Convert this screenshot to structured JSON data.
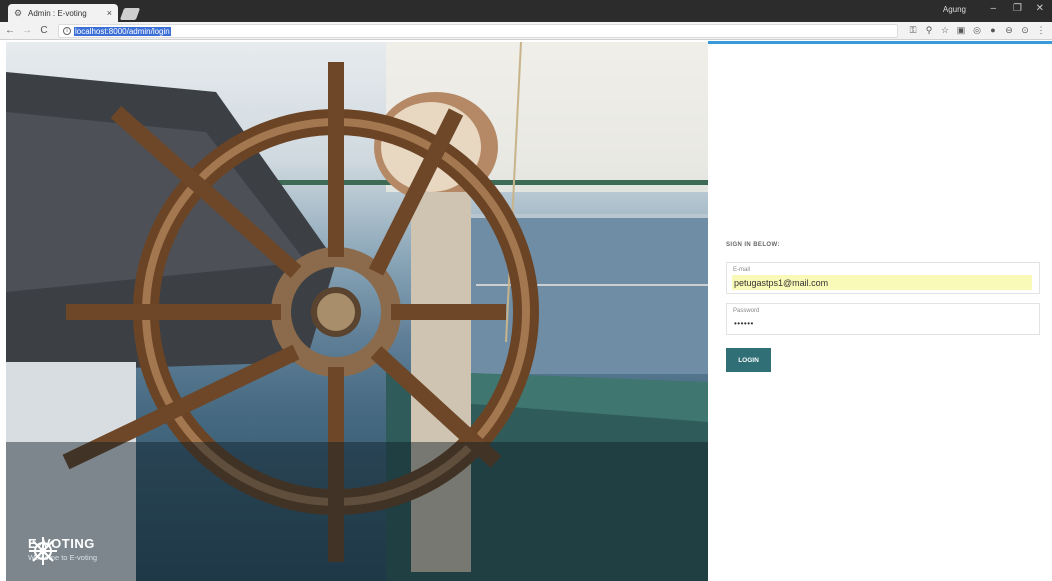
{
  "browser": {
    "tab_title": "Admin : E-voting",
    "tab_close": "×",
    "user": "Agung",
    "win_min": "–",
    "win_max": "❐",
    "win_close": "✕",
    "back": "←",
    "forward": "→",
    "reload": "C",
    "info": "i",
    "url": "localhost:8000/admin/login"
  },
  "brand": {
    "name": "E-VOTING",
    "tagline": "Welcome to E-voting"
  },
  "form": {
    "heading": "SIGN IN BELOW:",
    "email_label": "E-mail",
    "email_value": "petugastps1@mail.com",
    "password_label": "Password",
    "password_value": "••••••",
    "login_label": "LOGIN"
  },
  "colors": {
    "accent_bar": "#3a9ad9",
    "login_button": "#2f6f75",
    "autofill": "#fafab8"
  },
  "icons": [
    "settings-gear-icon",
    "key-icon",
    "zoom-icon",
    "star-icon",
    "extension-icon",
    "menu-dots-icon",
    "ship-wheel-logo-icon"
  ]
}
